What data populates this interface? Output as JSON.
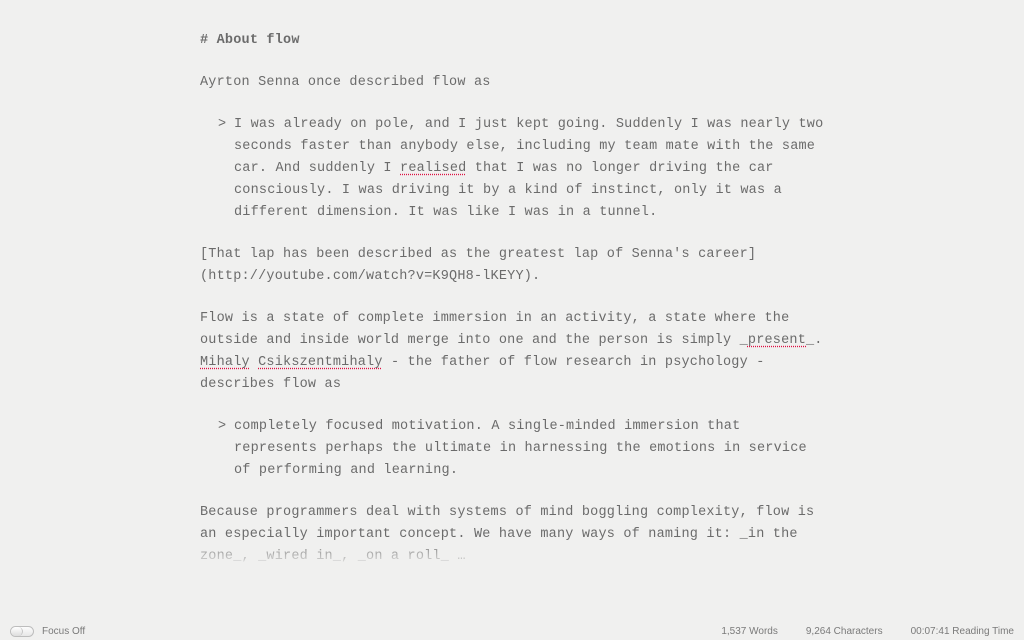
{
  "heading": {
    "marker": "#",
    "text": "About flow"
  },
  "body": {
    "para1_intro": "Ayrton Senna once described flow as",
    "quote1_pre": "I was already on pole, and I just kept going. Suddenly I was nearly two seconds faster than anybody else, including my team mate with the same car. And suddenly I ",
    "quote1_spell": "realised",
    "quote1_post": " that I was no longer driving the car consciously. I was driving it by a kind of instinct, only it was a different dimension. It was like I was in a tunnel.",
    "link_para": "[That lap has been described as the greatest lap of Senna's career](http://youtube.com/watch?v=K9QH8-lKEYY).",
    "para3_a": "Flow is a state of complete immersion in an activity, a state where the outside and inside world merge into one and the person is simply _",
    "para3_present": "present",
    "para3_b": "_. ",
    "para3_mihaly": "Mihaly",
    "para3_sp": " ",
    "para3_csik": "Csikszentmihaly",
    "para3_c": " - the father of flow research in psychology - describes flow as",
    "quote2": "completely focused motivation. A single-minded immersion that represents perhaps the ultimate in harnessing the emotions in service of performing and learning.",
    "para4": "Because programmers deal with systems of mind boggling complexity, flow is an especially important concept. We have many ways of naming it: _in the zone_, _wired in_, _on a roll_ …"
  },
  "status": {
    "focus_label": "Focus Off",
    "words_value": "1,537",
    "words_label": "Words",
    "chars_value": "9,264",
    "chars_label": "Characters",
    "time_value": "00:07:41",
    "time_label": "Reading Time"
  }
}
